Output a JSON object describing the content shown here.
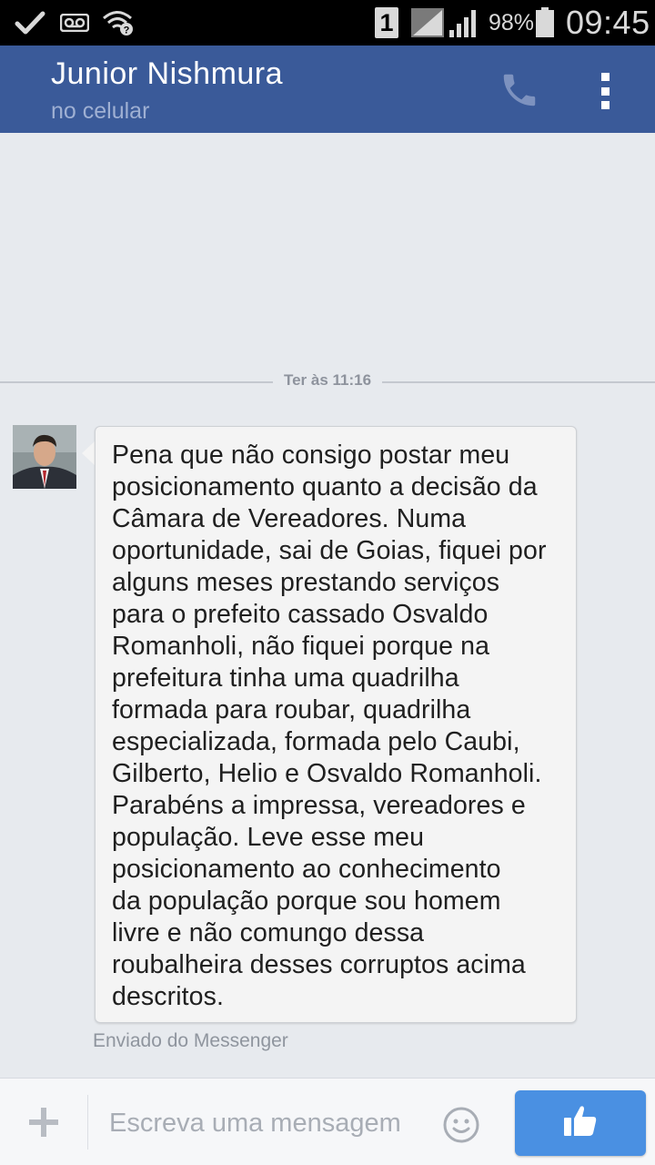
{
  "status_bar": {
    "sim_slot": "1",
    "battery_percent": "98%",
    "time": "09:45",
    "icons": [
      "check-icon",
      "voicemail-icon",
      "wifi-unknown-icon",
      "sim-icon",
      "signal-icon",
      "signal-icon",
      "battery-icon"
    ]
  },
  "header": {
    "contact_name": "Junior Nishmura",
    "subtitle": "no celular",
    "icons": [
      "phone-icon",
      "overflow-menu-icon"
    ]
  },
  "conversation": {
    "date_separator": "Ter às 11:16",
    "messages": [
      {
        "text": "Pena que não consigo postar meu\nposicionamento quanto a decisão da\nCâmara de Vereadores. Numa\noportunidade, sai de Goias, fiquei por\nalguns meses prestando serviços\npara o prefeito cassado Osvaldo\nRomanholi, não fiquei porque na\nprefeitura tinha uma quadrilha\nformada para roubar, quadrilha\nespecializada, formada pelo Caubi,\nGilberto, Helio e Osvaldo Romanholi.\nParabéns a impressa, vereadores e\npopulação. Leve esse meu\nposicionamento ao conhecimento\nda população porque sou homem\nlivre e não comungo dessa\nroubalheira desses corruptos acima\ndescritos.",
        "footer": "Enviado do Messenger"
      }
    ]
  },
  "composer": {
    "placeholder": "Escreva uma mensagem",
    "icons": [
      "plus-icon",
      "emoji-icon",
      "thumbs-up-icon"
    ],
    "like_button_color": "#4a90e2"
  },
  "colors": {
    "header_bg": "#3a5a99",
    "conversation_bg": "#e7eaee",
    "bubble_bg": "#f4f4f4"
  }
}
